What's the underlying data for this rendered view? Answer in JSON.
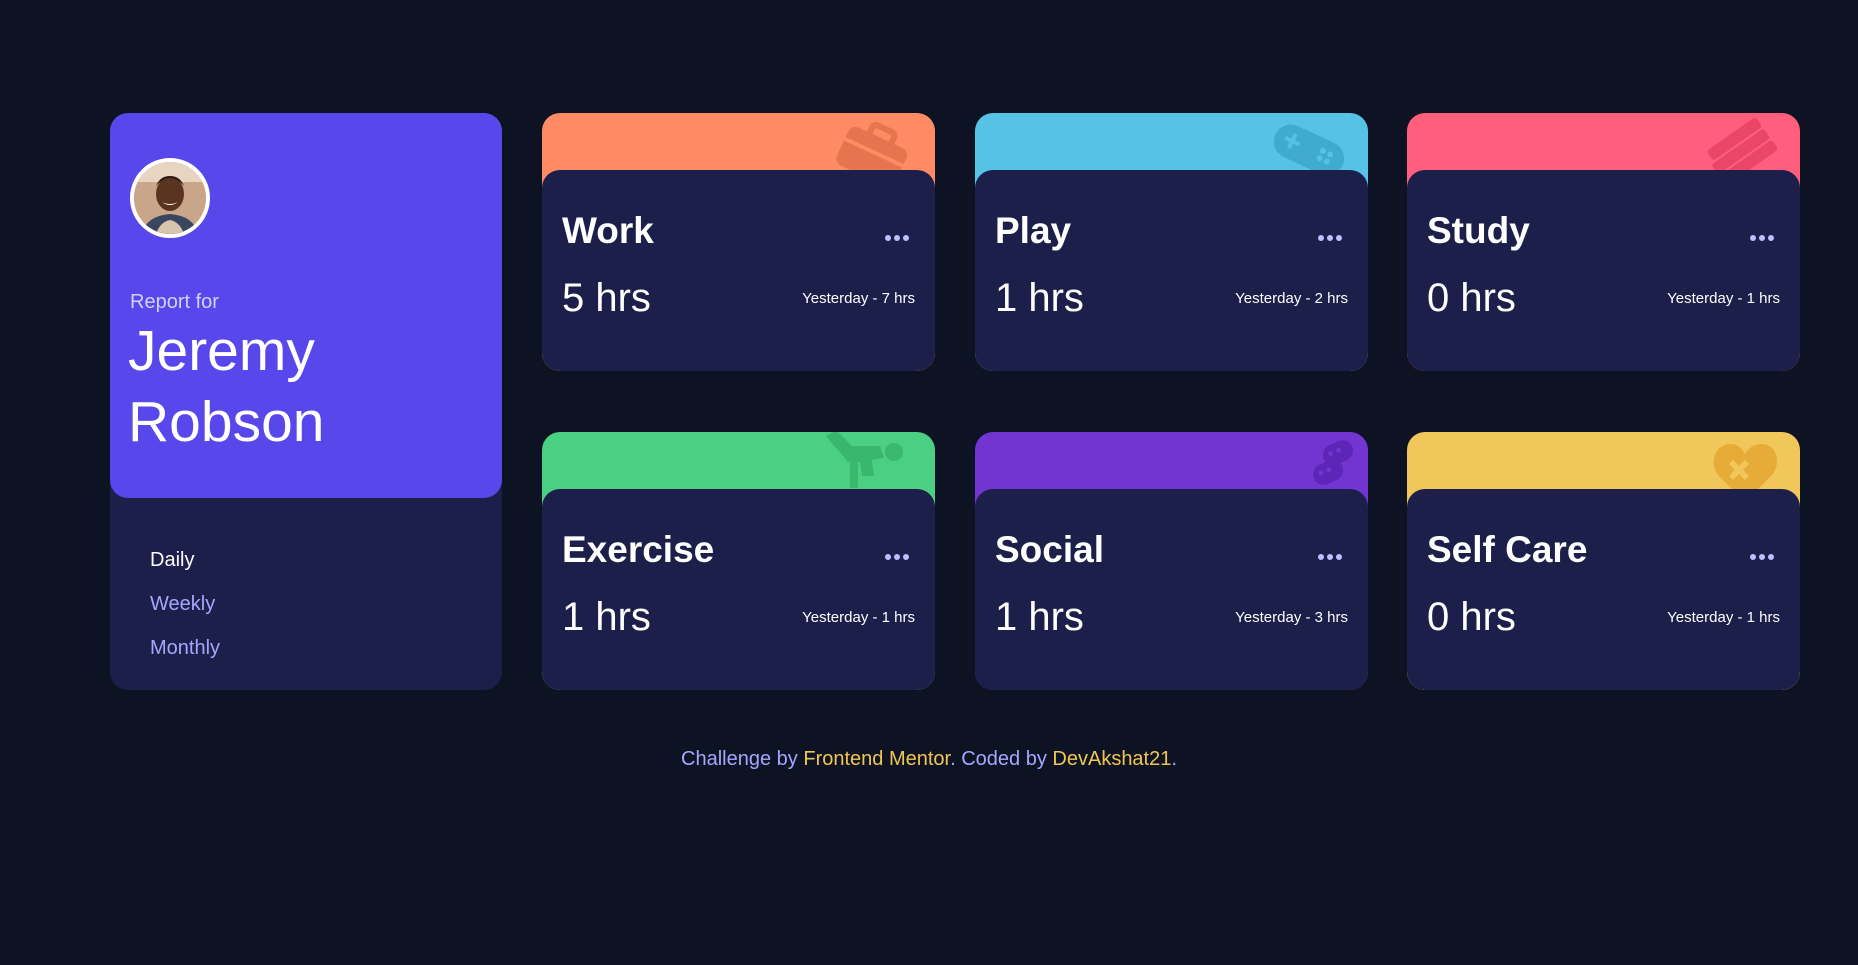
{
  "profile": {
    "report_for": "Report for",
    "first_name": "Jeremy",
    "last_name": "Robson",
    "avatar_icon": "avatar-photo"
  },
  "timeframes": [
    {
      "label": "Daily",
      "active": true
    },
    {
      "label": "Weekly",
      "active": false
    },
    {
      "label": "Monthly",
      "active": false
    }
  ],
  "activities": [
    {
      "title": "Work",
      "hours": "5 hrs",
      "previous": "Yesterday - 7 hrs",
      "color": "#ff8b64",
      "icon": "briefcase-icon"
    },
    {
      "title": "Play",
      "hours": "1 hrs",
      "previous": "Yesterday - 2 hrs",
      "color": "#55c2e6",
      "icon": "gamepad-icon"
    },
    {
      "title": "Study",
      "hours": "0 hrs",
      "previous": "Yesterday - 1 hrs",
      "color": "#ff5e7d",
      "icon": "books-icon"
    },
    {
      "title": "Exercise",
      "hours": "1 hrs",
      "previous": "Yesterday - 1 hrs",
      "color": "#4bcf82",
      "icon": "runner-icon"
    },
    {
      "title": "Social",
      "hours": "1 hrs",
      "previous": "Yesterday - 3 hrs",
      "color": "#7335d2",
      "icon": "chat-bubbles-icon"
    },
    {
      "title": "Self Care",
      "hours": "0 hrs",
      "previous": "Yesterday - 1 hrs",
      "color": "#f1c75b",
      "icon": "heart-icon"
    }
  ],
  "footer": {
    "prefix": "Challenge by ",
    "link1": "Frontend Mentor",
    "middle": ". Coded by ",
    "link2": "DevAkshat21",
    "suffix": "."
  }
}
